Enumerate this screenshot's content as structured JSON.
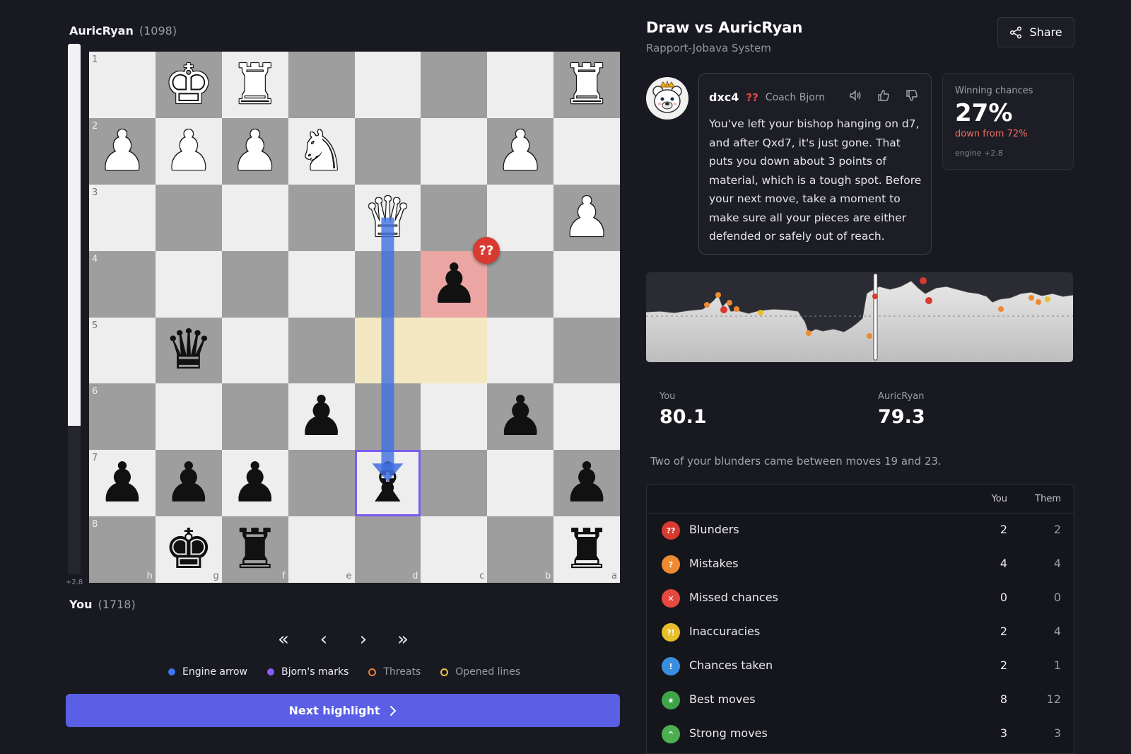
{
  "players": {
    "top": {
      "name": "AuricRyan",
      "rating": "(1098)"
    },
    "bottom": {
      "name": "You",
      "rating": "(1718)"
    }
  },
  "eval_bar": {
    "label": "+2.8",
    "white_fraction": 0.72
  },
  "board": {
    "ranks": [
      "1",
      "2",
      "3",
      "4",
      "5",
      "6",
      "7",
      "8"
    ],
    "files": [
      "h",
      "g",
      "f",
      "e",
      "d",
      "c",
      "b",
      "a"
    ],
    "rows": [
      [
        "",
        "wK",
        "wR",
        "",
        "",
        "",
        "",
        "wR"
      ],
      [
        "wP",
        "wP",
        "wP",
        "wN",
        "",
        "",
        "wP",
        ""
      ],
      [
        "",
        "",
        "",
        "",
        "wQ",
        "",
        "",
        "wP"
      ],
      [
        "",
        "",
        "",
        "",
        "",
        "bP",
        "",
        ""
      ],
      [
        "",
        "bQ",
        "",
        "",
        "",
        "",
        "",
        ""
      ],
      [
        "",
        "",
        "",
        "bP",
        "",
        "",
        "bP",
        ""
      ],
      [
        "bP",
        "bP",
        "bP",
        "",
        "bB",
        "",
        "",
        "bP"
      ],
      [
        "",
        "bK",
        "bR",
        "",
        "",
        "",
        "",
        "bR"
      ]
    ],
    "highlights": {
      "yellow": [
        [
          4,
          4
        ],
        [
          4,
          5
        ]
      ],
      "red": [
        [
          3,
          5
        ]
      ],
      "purple": [
        [
          6,
          4
        ]
      ]
    },
    "arrow": {
      "from": [
        2,
        4
      ],
      "to": [
        6,
        4
      ],
      "color": "#3f6fe0"
    },
    "blunder_badge": "??"
  },
  "nav": {
    "first": "«",
    "prev": "‹",
    "next": "›",
    "last": "»"
  },
  "legend": [
    {
      "label": "Engine arrow",
      "color": "#3b76f0",
      "style": "dot"
    },
    {
      "label": "Bjorn's marks",
      "color": "#8a5cf5",
      "style": "dot"
    },
    {
      "label": "Threats",
      "color": "#f07c3a",
      "style": "ring"
    },
    {
      "label": "Opened lines",
      "color": "#e8c53a",
      "style": "ring"
    }
  ],
  "next_button": {
    "label": "Next highlight",
    "icon": "chevron-right-icon"
  },
  "header": {
    "title": "Draw vs AuricRyan",
    "subtitle": "Rapport-Jobava System",
    "share_label": "Share"
  },
  "coach": {
    "move": "dxc4",
    "annotation": "??",
    "name": "Coach Bjorn",
    "message": "You've left your bishop hanging on d7, and after Qxd7, it's just gone. That puts you down about 3 points of material, which is a tough spot. Before your next move, take a moment to make sure all your pieces are either defended or safely out of reach."
  },
  "winning": {
    "label": "Winning chances",
    "percent": "27%",
    "delta": "down from 72%",
    "engine": "engine +2.8"
  },
  "scores": {
    "you": {
      "label": "You",
      "value": "80.1"
    },
    "them": {
      "label": "AuricRyan",
      "value": "79.3"
    }
  },
  "summary": "Two of your blunders came between moves 19 and 23.",
  "table": {
    "headers": {
      "you": "You",
      "them": "Them"
    },
    "rows": [
      {
        "name": "Blunders",
        "you": "2",
        "them": "2",
        "icon": "??",
        "color": "#d83a30"
      },
      {
        "name": "Mistakes",
        "you": "4",
        "them": "4",
        "icon": "?",
        "color": "#ee8a2f"
      },
      {
        "name": "Missed chances",
        "you": "0",
        "them": "0",
        "icon": "✕",
        "color": "#e5483e"
      },
      {
        "name": "Inaccuracies",
        "you": "2",
        "them": "4",
        "icon": "?!",
        "color": "#e8bf2b"
      },
      {
        "name": "Chances taken",
        "you": "2",
        "them": "1",
        "icon": "!",
        "color": "#3a8ee0"
      },
      {
        "name": "Best moves",
        "you": "8",
        "them": "12",
        "icon": "★",
        "color": "#3fa348"
      },
      {
        "name": "Strong moves",
        "you": "3",
        "them": "3",
        "icon": "^",
        "color": "#4caf50"
      }
    ]
  }
}
